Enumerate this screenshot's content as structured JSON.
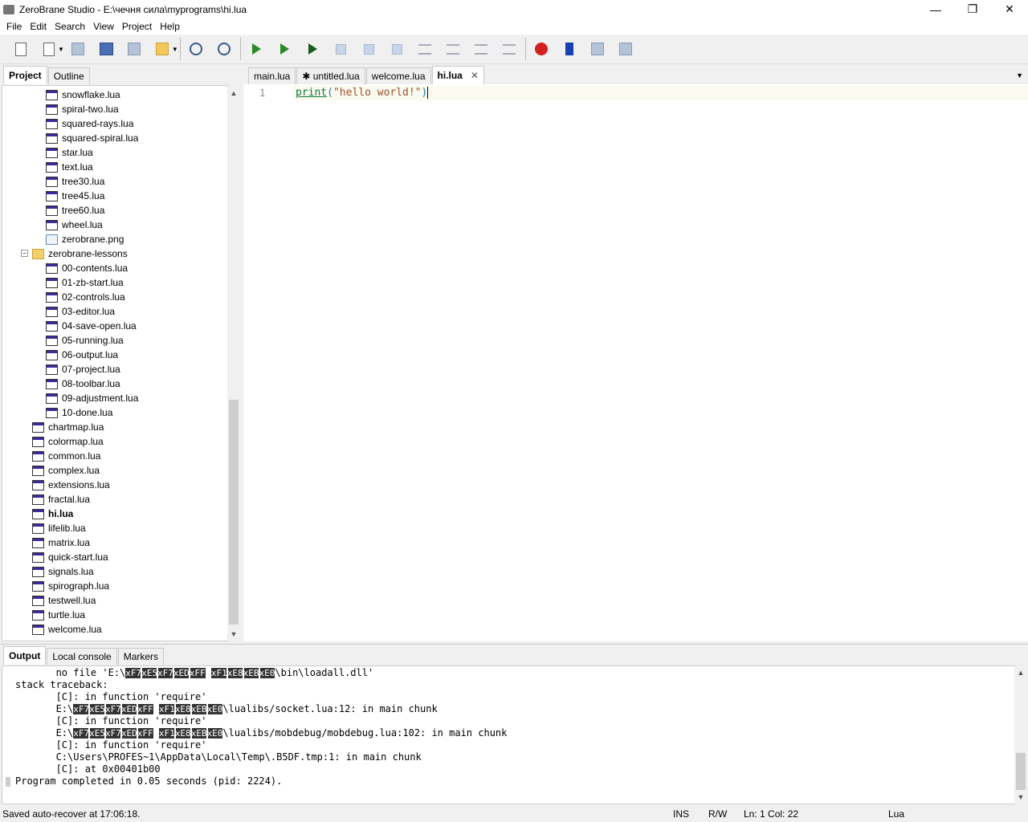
{
  "window": {
    "title": "ZeroBrane Studio - E:\\чечня сила\\myprograms\\hi.lua",
    "minimize": "—",
    "maximize": "❐",
    "close": "✕"
  },
  "menu": [
    "File",
    "Edit",
    "Search",
    "View",
    "Project",
    "Help"
  ],
  "left_tabs": [
    "Project",
    "Outline"
  ],
  "tree": [
    {
      "name": "snowflake.lua",
      "type": "lua",
      "level": 2
    },
    {
      "name": "spiral-two.lua",
      "type": "lua",
      "level": 2
    },
    {
      "name": "squared-rays.lua",
      "type": "lua",
      "level": 2
    },
    {
      "name": "squared-spiral.lua",
      "type": "lua",
      "level": 2
    },
    {
      "name": "star.lua",
      "type": "lua",
      "level": 2
    },
    {
      "name": "text.lua",
      "type": "lua",
      "level": 2
    },
    {
      "name": "tree30.lua",
      "type": "lua",
      "level": 2
    },
    {
      "name": "tree45.lua",
      "type": "lua",
      "level": 2
    },
    {
      "name": "tree60.lua",
      "type": "lua",
      "level": 2
    },
    {
      "name": "wheel.lua",
      "type": "lua",
      "level": 2
    },
    {
      "name": "zerobrane.png",
      "type": "png",
      "level": 2
    },
    {
      "name": "zerobrane-lessons",
      "type": "folder",
      "level": 1,
      "expanded": true
    },
    {
      "name": "00-contents.lua",
      "type": "lua",
      "level": 2
    },
    {
      "name": "01-zb-start.lua",
      "type": "lua",
      "level": 2
    },
    {
      "name": "02-controls.lua",
      "type": "lua",
      "level": 2
    },
    {
      "name": "03-editor.lua",
      "type": "lua",
      "level": 2
    },
    {
      "name": "04-save-open.lua",
      "type": "lua",
      "level": 2
    },
    {
      "name": "05-running.lua",
      "type": "lua",
      "level": 2
    },
    {
      "name": "06-output.lua",
      "type": "lua",
      "level": 2
    },
    {
      "name": "07-project.lua",
      "type": "lua",
      "level": 2
    },
    {
      "name": "08-toolbar.lua",
      "type": "lua",
      "level": 2
    },
    {
      "name": "09-adjustment.lua",
      "type": "lua",
      "level": 2
    },
    {
      "name": "10-done.lua",
      "type": "lua",
      "level": 2
    },
    {
      "name": "chartmap.lua",
      "type": "lua",
      "level": 1
    },
    {
      "name": "colormap.lua",
      "type": "lua",
      "level": 1
    },
    {
      "name": "common.lua",
      "type": "lua",
      "level": 1
    },
    {
      "name": "complex.lua",
      "type": "lua",
      "level": 1
    },
    {
      "name": "extensions.lua",
      "type": "lua",
      "level": 1
    },
    {
      "name": "fractal.lua",
      "type": "lua",
      "level": 1
    },
    {
      "name": "hi.lua",
      "type": "lua",
      "level": 1,
      "bold": true
    },
    {
      "name": "lifelib.lua",
      "type": "lua",
      "level": 1
    },
    {
      "name": "matrix.lua",
      "type": "lua",
      "level": 1
    },
    {
      "name": "quick-start.lua",
      "type": "lua",
      "level": 1
    },
    {
      "name": "signals.lua",
      "type": "lua",
      "level": 1
    },
    {
      "name": "spirograph.lua",
      "type": "lua",
      "level": 1
    },
    {
      "name": "testwell.lua",
      "type": "lua",
      "level": 1
    },
    {
      "name": "turtle.lua",
      "type": "lua",
      "level": 1
    },
    {
      "name": "welcome.lua",
      "type": "lua",
      "level": 1
    }
  ],
  "editor_tabs": [
    {
      "label": "main.lua"
    },
    {
      "label": "✱ untitled.lua"
    },
    {
      "label": "welcome.lua"
    },
    {
      "label": "hi.lua",
      "active": true
    }
  ],
  "editor_tab_close": "✕",
  "code": {
    "line_number": "1",
    "func": "print",
    "open": "(",
    "string": "\"hello world!\"",
    "close": ")"
  },
  "bottom_tabs": [
    "Output",
    "Local console",
    "Markers"
  ],
  "output_lines": [
    {
      "indent": "       ",
      "segs": [
        {
          "t": "no file 'E:\\"
        },
        {
          "t": "xF7",
          "hl": 1
        },
        {
          "t": "xE5",
          "hl": 1
        },
        {
          "t": "xF7",
          "hl": 1
        },
        {
          "t": "xED",
          "hl": 1
        },
        {
          "t": "xFF",
          "hl": 1
        },
        {
          "t": " "
        },
        {
          "t": "xF1",
          "hl": 1
        },
        {
          "t": "xE8",
          "hl": 1
        },
        {
          "t": "xEB",
          "hl": 1
        },
        {
          "t": "xE0",
          "hl": 1
        },
        {
          "t": "\\bin\\loadall.dll'"
        }
      ]
    },
    {
      "indent": "",
      "segs": [
        {
          "t": "stack traceback:"
        }
      ]
    },
    {
      "indent": "       ",
      "segs": [
        {
          "t": "[C]: in function 'require'"
        }
      ]
    },
    {
      "indent": "       ",
      "segs": [
        {
          "t": "E:\\"
        },
        {
          "t": "xF7",
          "hl": 1
        },
        {
          "t": "xE5",
          "hl": 1
        },
        {
          "t": "xF7",
          "hl": 1
        },
        {
          "t": "xED",
          "hl": 1
        },
        {
          "t": "xFF",
          "hl": 1
        },
        {
          "t": " "
        },
        {
          "t": "xF1",
          "hl": 1
        },
        {
          "t": "xE8",
          "hl": 1
        },
        {
          "t": "xEB",
          "hl": 1
        },
        {
          "t": "xE0",
          "hl": 1
        },
        {
          "t": "\\lualibs/socket.lua:12: in main chunk"
        }
      ]
    },
    {
      "indent": "       ",
      "segs": [
        {
          "t": "[C]: in function 'require'"
        }
      ]
    },
    {
      "indent": "       ",
      "segs": [
        {
          "t": "E:\\"
        },
        {
          "t": "xF7",
          "hl": 1
        },
        {
          "t": "xE5",
          "hl": 1
        },
        {
          "t": "xF7",
          "hl": 1
        },
        {
          "t": "xED",
          "hl": 1
        },
        {
          "t": "xFF",
          "hl": 1
        },
        {
          "t": " "
        },
        {
          "t": "xF1",
          "hl": 1
        },
        {
          "t": "xE8",
          "hl": 1
        },
        {
          "t": "xEB",
          "hl": 1
        },
        {
          "t": "xE0",
          "hl": 1
        },
        {
          "t": "\\lualibs/mobdebug/mobdebug.lua:102: in main chunk"
        }
      ]
    },
    {
      "indent": "       ",
      "segs": [
        {
          "t": "[C]: in function 'require'"
        }
      ]
    },
    {
      "indent": "       ",
      "segs": [
        {
          "t": "C:\\Users\\PROFES~1\\AppData\\Local\\Temp\\.B5DF.tmp:1: in main chunk"
        }
      ]
    },
    {
      "indent": "       ",
      "segs": [
        {
          "t": "[C]: at 0x00401b00"
        }
      ]
    },
    {
      "indent": "",
      "segs": [
        {
          "t": "Program completed in 0.05 seconds (pid: 2224)."
        }
      ],
      "marker": true
    }
  ],
  "status": {
    "message": "Saved auto-recover at 17:06:18.",
    "mode": "INS",
    "access": "R/W",
    "position": "Ln: 1 Col: 22",
    "language": "Lua"
  }
}
